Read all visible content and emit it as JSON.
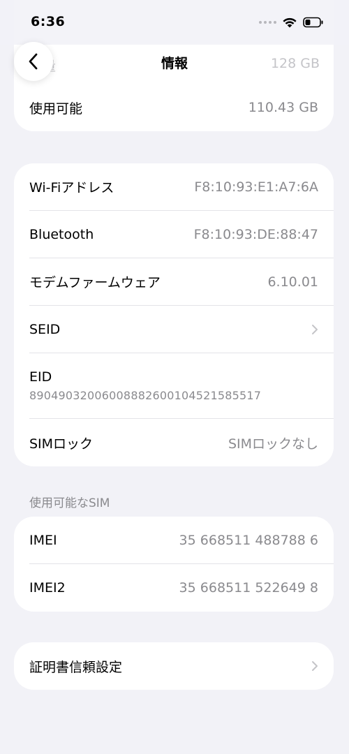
{
  "status_bar": {
    "time": "6:36"
  },
  "nav": {
    "title": "情報"
  },
  "storage_card": {
    "hidden_row": {
      "label": "容量",
      "value": "128 GB"
    },
    "available": {
      "label": "使用可能",
      "value": "110.43 GB"
    }
  },
  "network_card": {
    "rows": [
      {
        "label": "Wi-Fiアドレス",
        "value": "F8:10:93:E1:A7:6A"
      },
      {
        "label": "Bluetooth",
        "value": "F8:10:93:DE:88:47"
      },
      {
        "label": "モデムファームウェア",
        "value": "6.10.01"
      },
      {
        "label": "SEID"
      },
      {
        "label": "EID",
        "value": "89049032006008882600104521585517"
      },
      {
        "label": "SIMロック",
        "value": "SIMロックなし"
      }
    ]
  },
  "sim_section": {
    "header": "使用可能なSIM",
    "rows": [
      {
        "label": "IMEI",
        "value": "35 668511 488788 6"
      },
      {
        "label": "IMEI2",
        "value": "35 668511 522649 8"
      }
    ]
  },
  "cert_card": {
    "label": "証明書信頼設定"
  },
  "colors": {
    "background": "#f2f2f7",
    "card": "#ffffff",
    "secondary_text": "#8a8a8e",
    "separator": "#e3e3e8"
  }
}
